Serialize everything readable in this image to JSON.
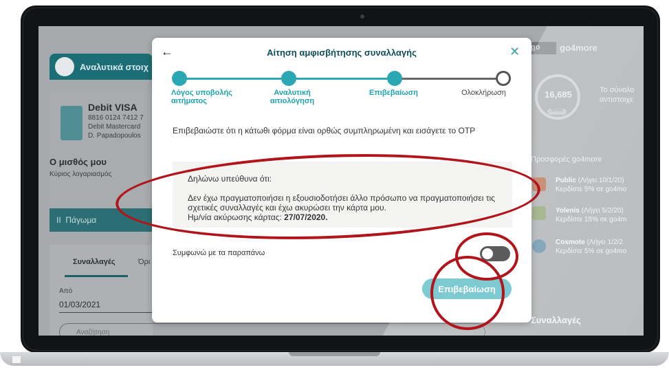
{
  "modal": {
    "back_icon": "←",
    "close_icon": "✕",
    "title": "Αίτηση αμφισβήτησης συναλλαγής",
    "steps": [
      {
        "label": "Λόγος υποβολής αιτήματος",
        "state": "done"
      },
      {
        "label": "Αναλυτική αιτιολόγηση",
        "state": "done"
      },
      {
        "label": "Επιβεβαίωση",
        "state": "current"
      },
      {
        "label": "Ολοκλήρωση",
        "state": "pending"
      }
    ],
    "intro": "Επιβεβαιώστε ότι η κάτωθι φόρμα είναι ορθώς συμπληρωμένη και εισάγετε το OTP",
    "declaration_heading": "Δηλώνω υπεύθυνα ότι:",
    "declaration_text": "Δεν έχω πραγματοποιήσει η εξουσιοδοτήσει άλλο πρόσωπο να πραγματοποιήσει τις σχετικές συναλλαγές και έχω ακυρώσει την κάρτα μου.",
    "cancel_date_label": "Ημ/νία ακύρωσης κάρτας:",
    "cancel_date": "27/07/2020.",
    "agree_label": "Συμφωνώ με τα παραπάνω",
    "agree_on": false,
    "confirm_label": "Επιβεβαίωση"
  },
  "background_left": {
    "section_title": "Αναλυτικά στοιχ",
    "card_name": "Debit VISA",
    "card_number": "8816 0124 7412 7",
    "card_type": "Debit Mastercard",
    "card_holder": "D. Papadopoulos",
    "account_name": "Ο μισθός μου",
    "account_sub": "Κύριος λογαριασμός",
    "freeze_label": "Πάγωμα",
    "tab_transactions": "Συναλλαγές",
    "tab_other": "Όρι",
    "from_label": "Από",
    "from_value": "01/03/2021",
    "search_placeholder": "Αναζήτηση"
  },
  "background_right": {
    "brand_logo": "go",
    "brand_name": "go4more",
    "points": "16,685",
    "points_chip": "πόντοι",
    "points_text_1": "Το σύνολο",
    "points_text_2": "αντιστοιχε",
    "offers_title": "Προσφορές go4more",
    "offers": [
      {
        "name": "Public",
        "expiry": "(Λήγει 10/1/20)",
        "desc": "Κερδίστε 5% σε go4mo"
      },
      {
        "name": "Yolenis",
        "expiry": "(Λήγει 5/2/20)",
        "desc": "Κερδίστε 15% σε go4m"
      },
      {
        "name": "Cosmote",
        "expiry": "(Λήγει 1/2/2",
        "desc": "Κερδίστε 5% σε go4mo"
      }
    ],
    "transactions_title": "Συναλλαγές"
  },
  "colors": {
    "accent": "#2ba6b3",
    "title": "#0e4e59",
    "confirm_button": "#7dcad2",
    "annotation": "#b1141b"
  }
}
